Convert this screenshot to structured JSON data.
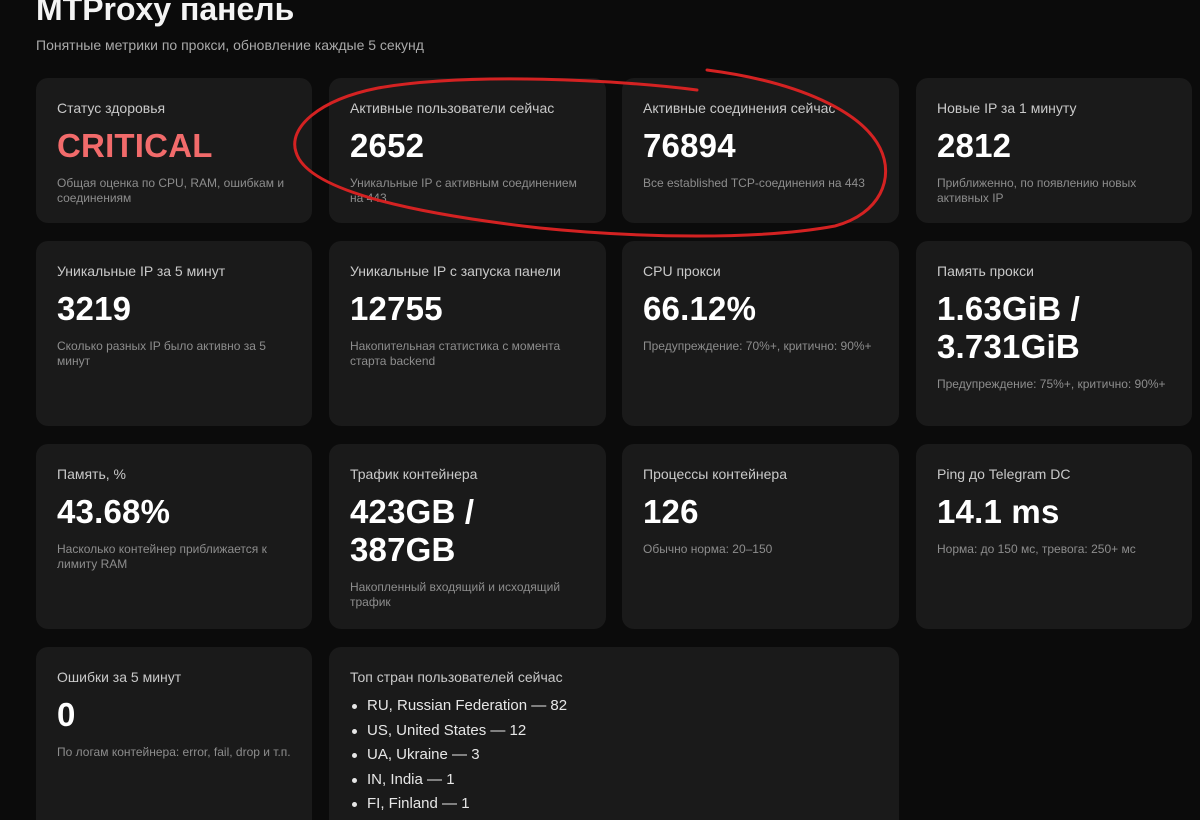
{
  "header": {
    "title": "MTProxy панель",
    "subtitle": "Понятные метрики по прокси, обновление каждые 5 секунд"
  },
  "cards": [
    {
      "label": "Статус здоровья",
      "value": "CRITICAL",
      "desc": "Общая оценка по CPU, RAM, ошибкам и соединениям"
    },
    {
      "label": "Активные пользователи сейчас",
      "value": "2652",
      "desc": "Уникальные IP с активным соединением на 443"
    },
    {
      "label": "Активные соединения сейчас",
      "value": "76894",
      "desc": "Все established TCP-соединения на 443"
    },
    {
      "label": "Новые IP за 1 минуту",
      "value": "2812",
      "desc": "Приближенно, по появлению новых активных IP"
    },
    {
      "label": "Уникальные IP за 5 минут",
      "value": "3219",
      "desc": "Сколько разных IP было активно за 5 минут"
    },
    {
      "label": "Уникальные IP с запуска панели",
      "value": "12755",
      "desc": "Накопительная статистика с момента старта backend"
    },
    {
      "label": "CPU прокси",
      "value": "66.12%",
      "desc": "Предупреждение: 70%+, критично: 90%+"
    },
    {
      "label": "Память прокси",
      "value_line1": "1.63GiB /",
      "value_line2": "3.731GiB",
      "desc": "Предупреждение: 75%+, критично: 90%+"
    },
    {
      "label": "Память, %",
      "value": "43.68%",
      "desc": "Насколько контейнер приближается к лимиту RAM"
    },
    {
      "label": "Трафик контейнера",
      "value_line1": "423GB /",
      "value_line2": "387GB",
      "desc": "Накопленный входящий и исходящий трафик"
    },
    {
      "label": "Процессы контейнера",
      "value": "126",
      "desc": "Обычно норма: 20–150"
    },
    {
      "label": "Ping до Telegram DC",
      "value": "14.1 ms",
      "desc": "Норма: до 150 мс, тревога: 250+ мс"
    },
    {
      "label": "Ошибки за 5 минут",
      "value": "0",
      "desc": "По логам контейнера: error, fail, drop и т.п."
    }
  ],
  "countries": {
    "label": "Топ стран пользователей сейчас",
    "items": [
      "RU, Russian Federation — 82",
      "US, United States — 12",
      "UA, Ukraine — 3",
      "IN, India — 1",
      "FI, Finland — 1"
    ]
  },
  "colors": {
    "background": "#0b0b0b",
    "card": "#1a1a1a",
    "critical": "#f26b6b",
    "annotation": "#d42222"
  }
}
